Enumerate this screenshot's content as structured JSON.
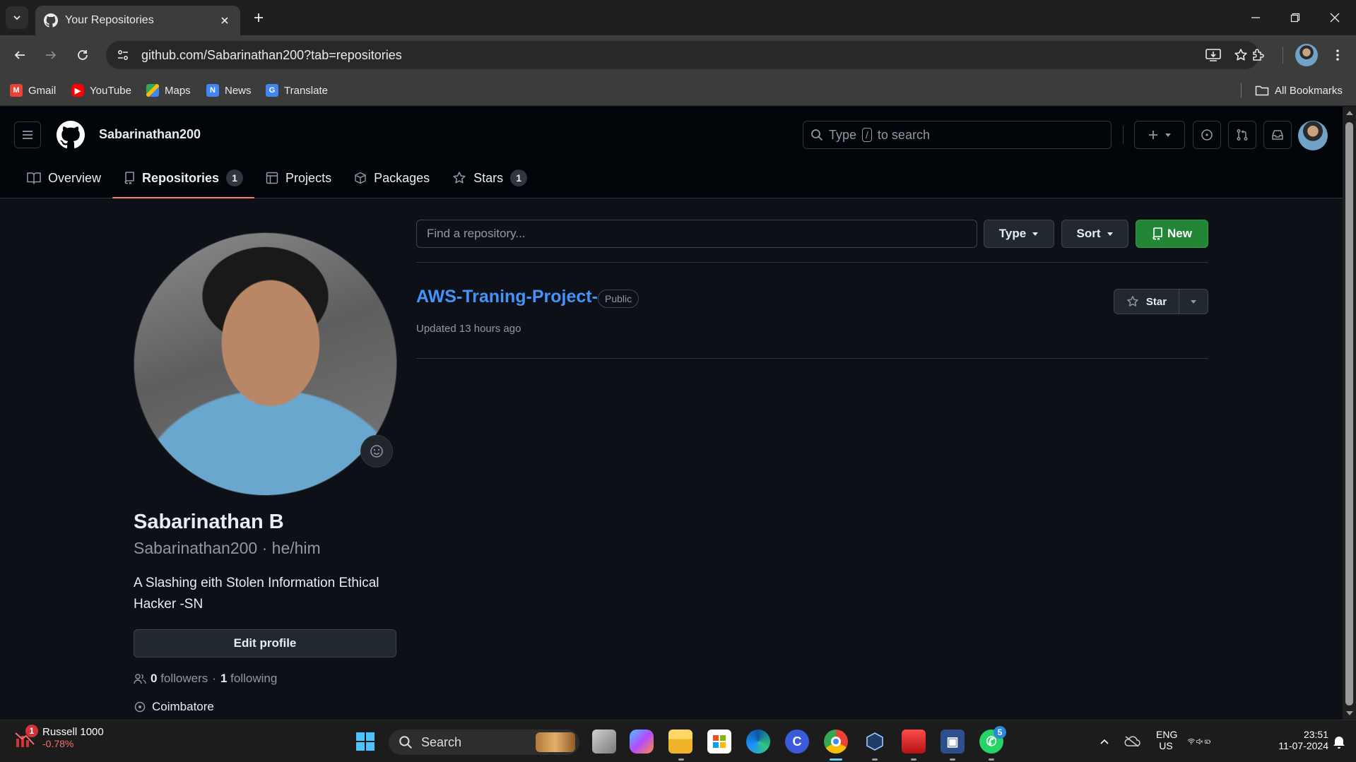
{
  "browser": {
    "tab_title": "Your Repositories",
    "url": "github.com/Sabarinathan200?tab=repositories",
    "bookmarks": [
      {
        "label": "Gmail",
        "icon": "gmail-icon",
        "color": "#ea4335"
      },
      {
        "label": "YouTube",
        "icon": "youtube-icon",
        "color": "#ff0000"
      },
      {
        "label": "Maps",
        "icon": "maps-icon",
        "color": "#34a853"
      },
      {
        "label": "News",
        "icon": "news-icon",
        "color": "#4285f4"
      },
      {
        "label": "Translate",
        "icon": "translate-icon",
        "color": "#4285f4"
      }
    ],
    "all_bookmarks": "All Bookmarks"
  },
  "github": {
    "username": "Sabarinathan200",
    "search_placeholder_before": "Type",
    "search_key": "/",
    "search_placeholder_after": "to search",
    "nav": [
      {
        "label": "Overview",
        "icon": "book-icon",
        "count": null
      },
      {
        "label": "Repositories",
        "icon": "repo-icon",
        "count": "1",
        "selected": true
      },
      {
        "label": "Projects",
        "icon": "table-icon",
        "count": null
      },
      {
        "label": "Packages",
        "icon": "package-icon",
        "count": null
      },
      {
        "label": "Stars",
        "icon": "star-icon",
        "count": "1"
      }
    ],
    "colors": {
      "accent": "#4493f8",
      "new_button": "#238636",
      "selected_underline": "#f78166"
    }
  },
  "profile": {
    "full_name": "Sabarinathan B",
    "login": "Sabarinathan200",
    "pronouns": "he/him",
    "bio": "A Slashing eith Stolen Information Ethical Hacker -SN",
    "edit_label": "Edit profile",
    "followers_count": "0",
    "followers_label": "followers",
    "following_count": "1",
    "following_label": "following",
    "location": "Coimbatore"
  },
  "repos": {
    "search_placeholder": "Find a repository...",
    "type_label": "Type",
    "sort_label": "Sort",
    "new_label": "New",
    "items": [
      {
        "name": "AWS-Traning-Project-",
        "visibility": "Public",
        "updated": "Updated 13 hours ago",
        "star_label": "Star"
      }
    ]
  },
  "taskbar": {
    "widget_title": "Russell 1000",
    "widget_sub": "-0.78%",
    "widget_badge": "1",
    "search_label": "Search",
    "whatsapp_badge": "5",
    "lang_top": "ENG",
    "lang_bottom": "US",
    "time": "23:51",
    "date": "11-07-2024"
  }
}
